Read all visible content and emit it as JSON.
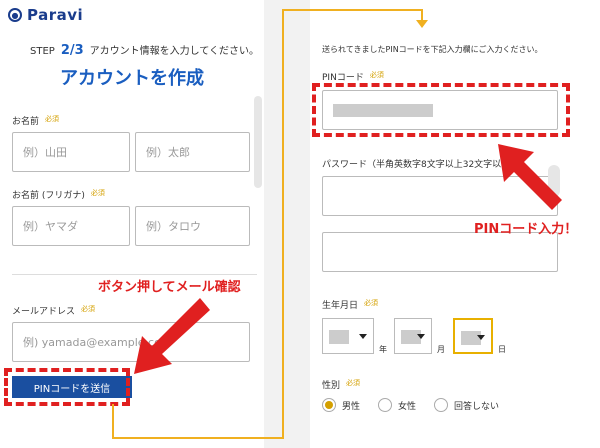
{
  "brand": {
    "logo_text": "Paravi"
  },
  "left": {
    "step_label": "STEP",
    "step_value": "2/3",
    "step_desc": "アカウント情報を入力してください。",
    "title": "アカウントを作成",
    "name_label": "お名前",
    "name_kana_label": "お名前 (フリガナ)",
    "email_label": "メールアドレス",
    "required": "必須",
    "last_name_placeholder": "例）山田",
    "first_name_placeholder": "例）太郎",
    "last_kana_placeholder": "例）ヤマダ",
    "first_kana_placeholder": "例）タロウ",
    "email_placeholder": "例) yamada@example.com",
    "send_pin_button": "PINコードを送信"
  },
  "right": {
    "instruction": "送られてきましたPINコードを下記入力欄にご入力ください。",
    "pin_label": "PINコード",
    "password_label": "パスワード（半角英数字8文字以上32文字以",
    "birthday_label": "生年月日",
    "year_unit": "年",
    "month_unit": "月",
    "day_unit": "日",
    "gender_label": "性別",
    "required": "必須",
    "gender_options": [
      "男性",
      "女性",
      "回答しない"
    ]
  },
  "annotations": {
    "button_note": "ボタン押してメール確認",
    "pin_note": "PINコード入力！"
  },
  "colors": {
    "accent": "#1a5ec0",
    "highlight": "#e02020",
    "required": "#d4a000",
    "connector": "#f0b020"
  }
}
